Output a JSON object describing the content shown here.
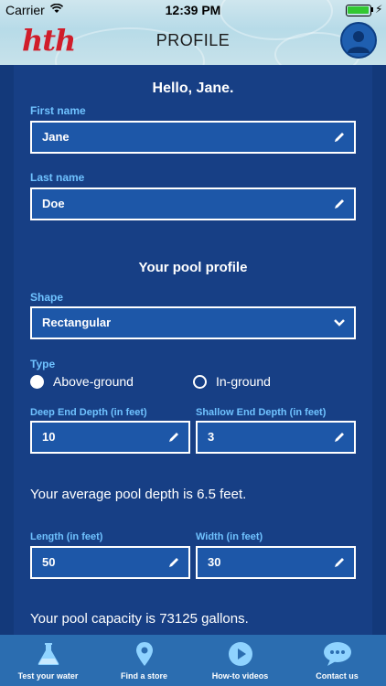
{
  "status_bar": {
    "carrier": "Carrier",
    "time": "12:39 PM"
  },
  "header": {
    "logo": "hth",
    "title": "PROFILE"
  },
  "greeting": "Hello, Jane.",
  "first_name": {
    "label": "First name",
    "value": "Jane"
  },
  "last_name": {
    "label": "Last name",
    "value": "Doe"
  },
  "pool_section_title": "Your pool profile",
  "shape": {
    "label": "Shape",
    "value": "Rectangular"
  },
  "type": {
    "label": "Type",
    "options": [
      {
        "label": "Above-ground",
        "selected": true
      },
      {
        "label": "In-ground",
        "selected": false
      }
    ]
  },
  "deep_end": {
    "label": "Deep End Depth (in feet)",
    "value": "10"
  },
  "shallow_end": {
    "label": "Shallow End Depth (in feet)",
    "value": "3"
  },
  "average_depth_text": "Your average pool depth is 6.5 feet.",
  "length": {
    "label": "Length (in feet)",
    "value": "50"
  },
  "width": {
    "label": "Width (in feet)",
    "value": "30"
  },
  "capacity_text": "Your pool capacity is 73125 gallons.",
  "tabs": [
    {
      "label": "Test your water",
      "icon": "flask-icon"
    },
    {
      "label": "Find a store",
      "icon": "location-pin-icon"
    },
    {
      "label": "How-to videos",
      "icon": "play-icon"
    },
    {
      "label": "Contact us",
      "icon": "chat-bubble-icon"
    }
  ],
  "colors": {
    "background": "#13397a",
    "panel": "#173f85",
    "field": "#1d57a8",
    "label": "#6fc2ff",
    "tabbar": "#2b6db0",
    "logo": "#d01d2a"
  }
}
